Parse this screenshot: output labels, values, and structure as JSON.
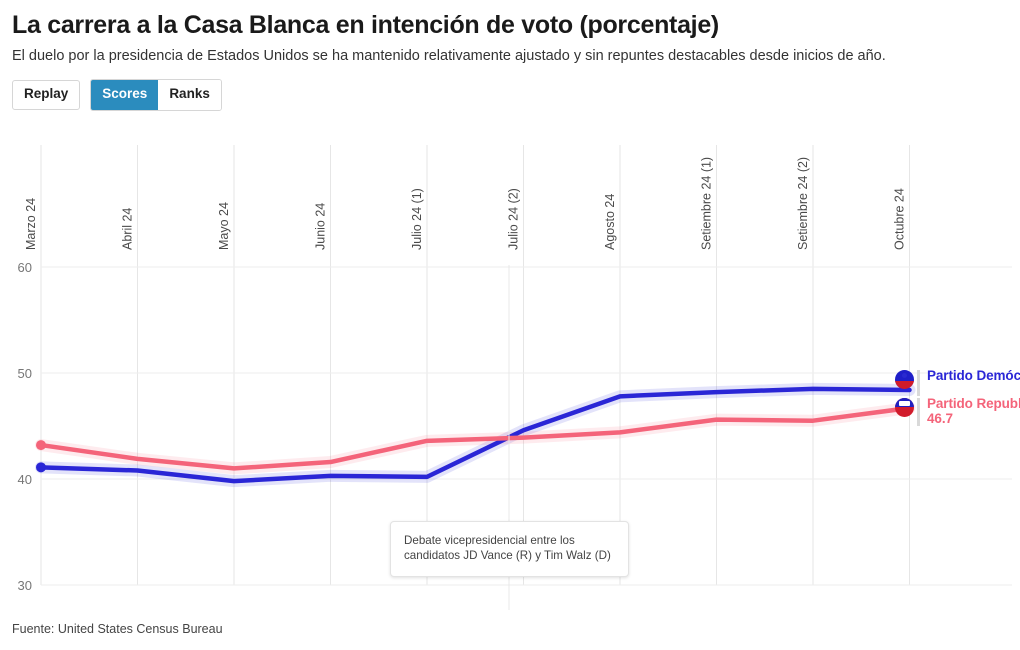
{
  "header": {
    "title": "La carrera a la Casa Blanca en intención de voto (porcentaje)",
    "subtitle": "El duelo por la presidencia de Estados Unidos se ha mantenido relativamente ajustado y sin repuntes destacables desde inicios de año."
  },
  "controls": {
    "replay_label": "Replay",
    "scores_label": "Scores",
    "ranks_label": "Ranks",
    "active": "Scores",
    "active_color": "#2b8cbe"
  },
  "annotation": {
    "text": "Debate vicepresidencial entre los candidatos JD Vance (R) y Tim Walz (D)"
  },
  "legend": {
    "democrat": {
      "label": "Partido Demócrata",
      "value": "",
      "color": "#2a26d6",
      "icon": "democratic-party-logo-icon"
    },
    "republican": {
      "label": "Partido Republicano",
      "value": "46.7",
      "color": "#f4647a",
      "icon": "republican-party-logo-icon"
    }
  },
  "footer": {
    "source": "Fuente: United States Census Bureau"
  },
  "chart_data": {
    "type": "line",
    "title": "La carrera a la Casa Blanca en intención de voto (porcentaje)",
    "subtitle": "El duelo por la presidencia de Estados Unidos se ha mantenido relativamente ajustado y sin repuntes destacables desde inicios de año.",
    "xlabel": "",
    "ylabel": "",
    "categories": [
      "Marzo 24",
      "Abril 24",
      "Mayo 24",
      "Junio 24",
      "Julio 24 (1)",
      "Julio 24 (2)",
      "Agosto 24",
      "Setiembre 24 (1)",
      "Setiembre 24 (2)",
      "Octubre 24"
    ],
    "yticks": [
      30,
      40,
      50,
      60
    ],
    "ylim": [
      28,
      61
    ],
    "grid": true,
    "legend_position": "right",
    "series": [
      {
        "name": "Partido Demócrata",
        "color": "#2a26d6",
        "values": [
          41.1,
          40.8,
          39.8,
          40.3,
          40.2,
          44.6,
          47.8,
          48.2,
          48.5,
          48.4
        ]
      },
      {
        "name": "Partido Republicano",
        "color": "#f4647a",
        "values": [
          43.2,
          41.9,
          41.0,
          41.6,
          43.6,
          43.9,
          44.4,
          45.6,
          45.5,
          46.7
        ]
      }
    ]
  }
}
